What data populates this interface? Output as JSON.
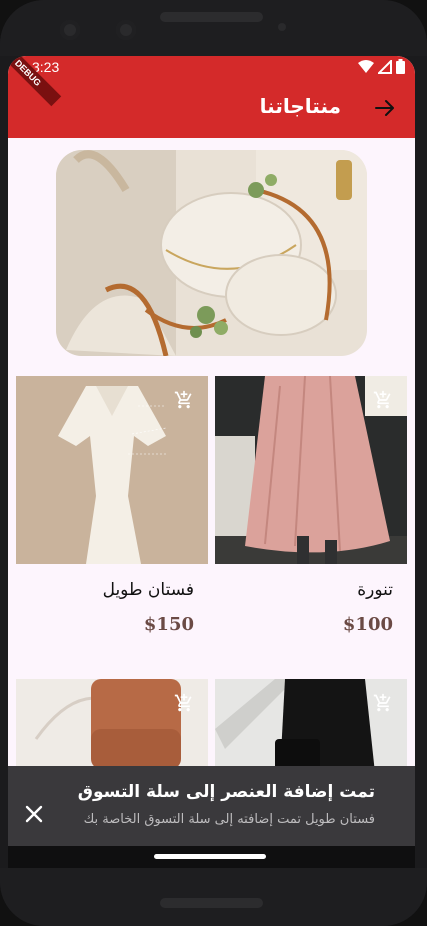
{
  "status": {
    "time": "3:23",
    "debug": "DEBUG"
  },
  "appbar": {
    "title": "منتاجاتنا",
    "back_icon": "arrow-forward-icon"
  },
  "products": [
    {
      "name": "فستان طويل",
      "price": "$150",
      "icon": "add-shopping-cart-icon"
    },
    {
      "name": "تنورة",
      "price": "$100",
      "icon": "add-shopping-cart-icon"
    }
  ],
  "snackbar": {
    "title": "تمت إضافة العنصر إلى سلة التسوق",
    "subtitle": "فستان طويل تمت إضافته إلى سلة التسوق الخاصة بك",
    "close_icon": "close-icon"
  },
  "colors": {
    "appbar": "#d42a2a",
    "background": "#fdf5fd",
    "price": "#6b4a45",
    "snackbar": "#3a393c"
  }
}
